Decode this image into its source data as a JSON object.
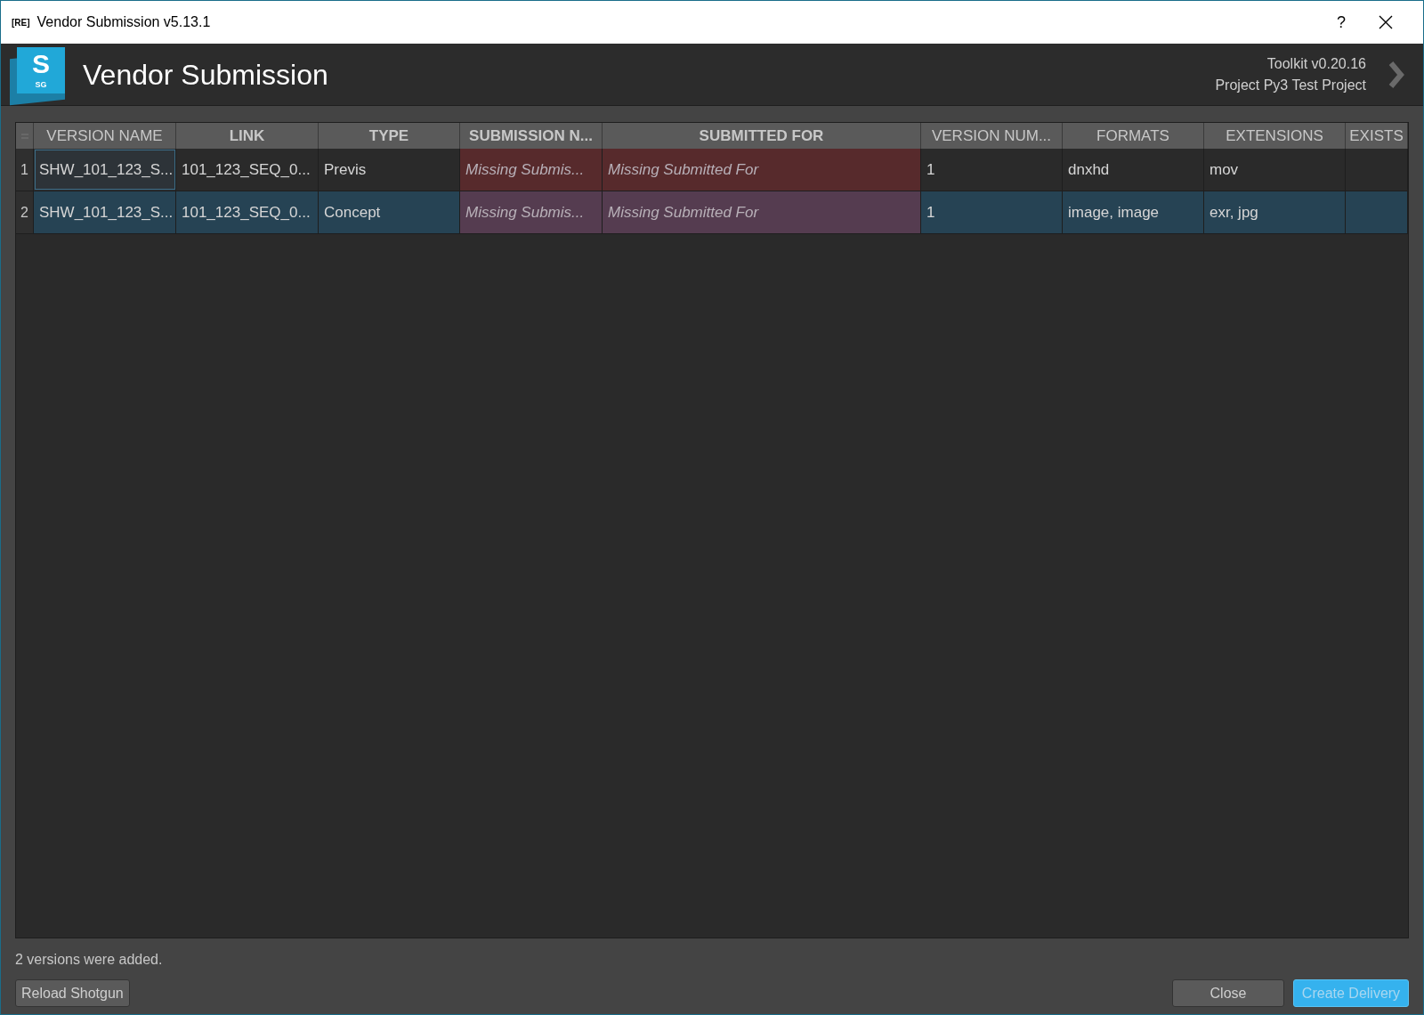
{
  "window": {
    "badge": "[RE]",
    "title": "Vendor Submission v5.13.1",
    "help": "?"
  },
  "header": {
    "logo_letter": "S",
    "logo_sub": "SG",
    "title": "Vendor Submission",
    "toolkit": "Toolkit v0.20.16",
    "project": "Project Py3 Test Project"
  },
  "table": {
    "columns": [
      {
        "label": "VERSION NAME",
        "bold": false
      },
      {
        "label": "LINK",
        "bold": true
      },
      {
        "label": "TYPE",
        "bold": true
      },
      {
        "label": "SUBMISSION N...",
        "bold": true
      },
      {
        "label": "SUBMITTED FOR",
        "bold": true
      },
      {
        "label": "VERSION NUM...",
        "bold": false
      },
      {
        "label": "FORMATS",
        "bold": false
      },
      {
        "label": "EXTENSIONS",
        "bold": false
      },
      {
        "label": "EXISTS",
        "bold": false
      }
    ],
    "rows": [
      {
        "number": "1",
        "selected": false,
        "focused": true,
        "cells": [
          {
            "text": "SHW_101_123_S...",
            "missing": false
          },
          {
            "text": "101_123_SEQ_0...",
            "missing": false
          },
          {
            "text": "Previs",
            "missing": false
          },
          {
            "text": "Missing Submis...",
            "missing": true
          },
          {
            "text": "Missing Submitted For",
            "missing": true
          },
          {
            "text": "1",
            "missing": false
          },
          {
            "text": "dnxhd",
            "missing": false
          },
          {
            "text": "mov",
            "missing": false
          }
        ]
      },
      {
        "number": "2",
        "selected": true,
        "focused": false,
        "cells": [
          {
            "text": "SHW_101_123_S...",
            "missing": false
          },
          {
            "text": "101_123_SEQ_0...",
            "missing": false
          },
          {
            "text": "Concept",
            "missing": false
          },
          {
            "text": "Missing Submis...",
            "missing": true
          },
          {
            "text": "Missing Submitted For",
            "missing": true
          },
          {
            "text": "1",
            "missing": false
          },
          {
            "text": "image, image",
            "missing": false
          },
          {
            "text": "exr, jpg",
            "missing": false
          }
        ]
      }
    ]
  },
  "status": "2 versions were added.",
  "buttons": [
    {
      "label": "Reload Shotgun",
      "kind": "normal"
    },
    {
      "label": "Close",
      "kind": "normal"
    },
    {
      "label": "Create Delivery",
      "kind": "primary"
    }
  ]
}
